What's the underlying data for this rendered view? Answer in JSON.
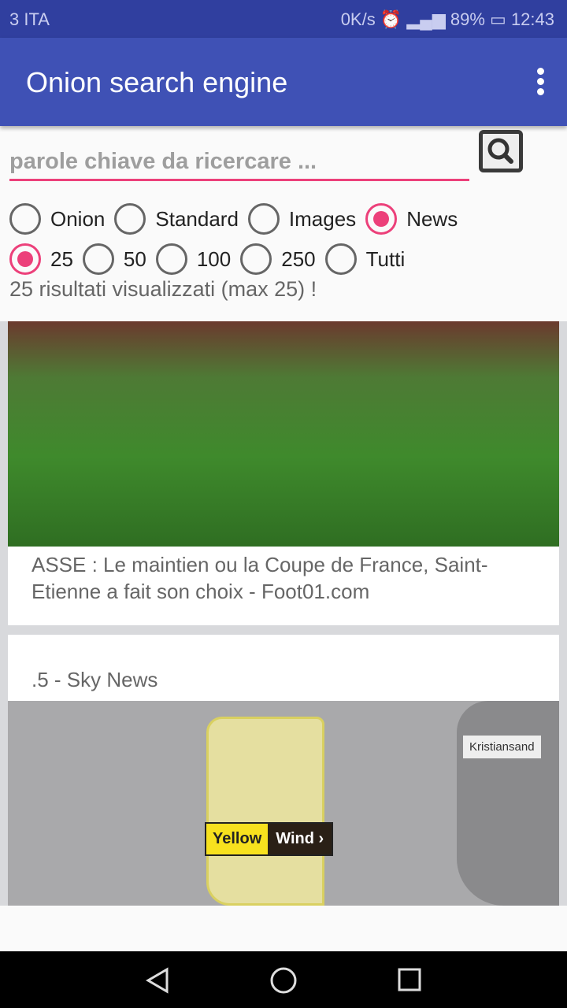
{
  "status_bar": {
    "carrier": "3 ITA",
    "speed": "0K/s",
    "battery": "89%",
    "time": "12:43"
  },
  "app_bar": {
    "title": "Onion search engine",
    "menu_icon": "more-vert-icon"
  },
  "search": {
    "placeholder": "parole chiave da ricercare ...",
    "value": "",
    "button_icon": "search-icon"
  },
  "type_options": [
    {
      "label": "Onion",
      "selected": false
    },
    {
      "label": "Standard",
      "selected": false
    },
    {
      "label": "Images",
      "selected": false
    },
    {
      "label": "News",
      "selected": true
    }
  ],
  "count_options": [
    {
      "label": "25",
      "selected": true
    },
    {
      "label": "50",
      "selected": false
    },
    {
      "label": "100",
      "selected": false
    },
    {
      "label": "250",
      "selected": false
    },
    {
      "label": "Tutti",
      "selected": false
    }
  ],
  "result_count": "25 risultati visualizzati (max 25) !",
  "accent_color": "#ec407a",
  "results": [
    {
      "caption": "ASSE : Le maintien ou la Coupe de France, Saint-Etienne a fait son choix - Foot01.com"
    },
    {
      "caption": ".5 - Sky News",
      "map_labels": {
        "city": "Kristiansand",
        "warning_level": "Yellow",
        "warning_type": "Wind ›"
      }
    }
  ]
}
